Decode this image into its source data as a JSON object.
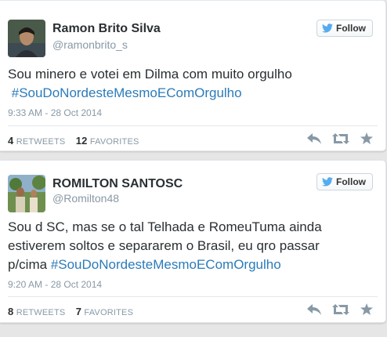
{
  "tweets": [
    {
      "name": "Ramon Brito Silva",
      "handle": "@ramonbrito_s",
      "follow_label": "Follow",
      "text": "Sou minero e votei em Dilma com muito orgulho",
      "hashtag": "#SouDoNordesteMesmoEComOrgulho",
      "time": "9:33 AM - 28 Oct 2014",
      "retweets": "4",
      "retweets_label": "retweets",
      "favorites": "12",
      "favorites_label": "favorites"
    },
    {
      "name": "ROMILTON SANTOSC",
      "handle": "@Romilton48",
      "follow_label": "Follow",
      "text": "Sou d SC, mas se o tal Telhada e RomeuTuma ainda estiverem soltos e separarem o Brasil, eu qro passar p/cima",
      "hashtag": "#SouDoNordesteMesmoEComOrgulho",
      "time": "9:20 AM - 28 Oct 2014",
      "retweets": "8",
      "retweets_label": "retweets",
      "favorites": "7",
      "favorites_label": "favorites"
    }
  ],
  "colors": {
    "link": "#2b7bb9",
    "muted": "#8899a6",
    "bird": "#55acee"
  }
}
